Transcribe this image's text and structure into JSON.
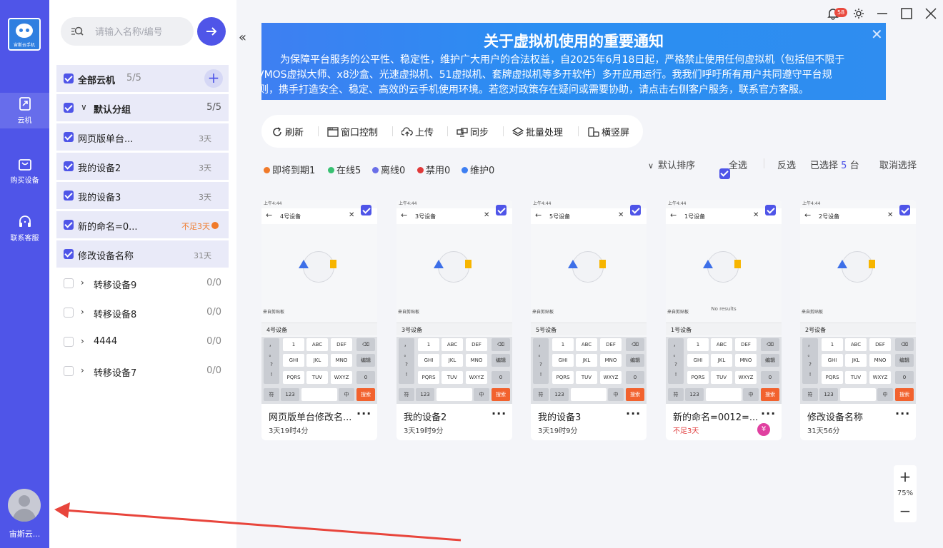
{
  "rail": {
    "logo_text": "宙斯云手机",
    "items": [
      {
        "label": "云机",
        "icon": "cloud-phone-icon"
      },
      {
        "label": "购买设备",
        "icon": "shopping-bag-icon"
      },
      {
        "label": "联系客服",
        "icon": "headset-icon"
      }
    ],
    "user_name": "宙斯云..."
  },
  "panel": {
    "search_placeholder": "请输入名称/编号",
    "groups": [
      {
        "label": "全部云机",
        "count": "5/5"
      },
      {
        "label": "默认分组",
        "count": "5/5"
      }
    ],
    "devices": [
      {
        "label": "网页版单台...",
        "days": "3天"
      },
      {
        "label": "我的设备2",
        "days": "3天"
      },
      {
        "label": "我的设备3",
        "days": "3天"
      },
      {
        "label": "新的命名=0...",
        "days": "不足3天"
      },
      {
        "label": "修改设备名称",
        "days": "31天"
      }
    ],
    "other_groups": [
      {
        "label": "转移设备9",
        "count": "0/0"
      },
      {
        "label": "转移设备8",
        "count": "0/0"
      },
      {
        "label": "4444",
        "count": "0/0"
      },
      {
        "label": "转移设备7",
        "count": "0/0"
      }
    ]
  },
  "titlebar": {
    "notif_count": "58"
  },
  "banner": {
    "title": "关于虚拟机使用的重要通知",
    "line1": "为保障平台服务的公平性、稳定性，维护广大用户的合法权益，自2025年6月18日起，严格禁止使用任何虚拟机（包括但不限于",
    "line2": "VMOS虚拟大师、x8沙盒、光速虚拟机、51虚拟机、套牌虚拟机等多开软件）多开应用运行。我我们呼吁所有用户共同遵守平台规",
    "line3": "则，携手打造安全、稳定、高效的云手机使用环境。若您对政策存在疑问或需要协助，请点击右侧客户服务，联系官方客服。"
  },
  "toolbar": {
    "refresh": "刷新",
    "window_control": "窗口控制",
    "upload": "上传",
    "sync": "同步",
    "batch": "批量处理",
    "orientation": "横竖屏"
  },
  "status": {
    "expiring": "即将到期1",
    "online": "在线5",
    "offline": "离线0",
    "disabled": "禁用0",
    "maintenance": "维护0"
  },
  "controls": {
    "sort": "默认排序",
    "select_all": "全选",
    "invert": "反选",
    "selected_prefix": "已选择",
    "selected_count": "5",
    "selected_suffix": "台",
    "cancel": "取消选择"
  },
  "keyboard": {
    "row1": [
      "'",
      "1",
      "ABC",
      "DEF"
    ],
    "row2": [
      "GHI",
      "JKL",
      "MNO"
    ],
    "row3": [
      "PQRS",
      "TUV",
      "WXYZ"
    ],
    "side": [
      "，",
      "。",
      "?",
      "!"
    ],
    "edit": "编辑",
    "zero": "0",
    "sym": "符",
    "num": "123",
    "zh": "中",
    "go": "搜索"
  },
  "cards": [
    {
      "screen_search": "4号设备",
      "clip_text": "来自剪贴板",
      "typed": "4号设备",
      "no_results": "",
      "name": "网页版单台修改名...",
      "time": "3天19时4分"
    },
    {
      "screen_search": "3号设备",
      "clip_text": "来自剪贴板",
      "typed": "3号设备",
      "no_results": "",
      "name": "我的设备2",
      "time": "3天19时9分"
    },
    {
      "screen_search": "5号设备",
      "clip_text": "来自剪贴板",
      "typed": "5号设备",
      "no_results": "",
      "name": "我的设备3",
      "time": "3天19时9分"
    },
    {
      "screen_search": "1号设备",
      "clip_text": "来自剪贴板",
      "typed": "1号设备",
      "no_results": "No results",
      "name": "新的命名=0012=...",
      "time": "不足3天"
    },
    {
      "screen_search": "2号设备",
      "clip_text": "来自剪贴板",
      "typed": "2号设备",
      "no_results": "",
      "name": "修改设备名称",
      "time": "31天56分"
    }
  ],
  "status_bar_text": "上午4:44",
  "zoom": {
    "level": "75%",
    "plus": "+",
    "minus": "−"
  },
  "colors": {
    "brand": "#4f55e8",
    "warn": "#f07a2a",
    "danger": "#e03a3a"
  }
}
